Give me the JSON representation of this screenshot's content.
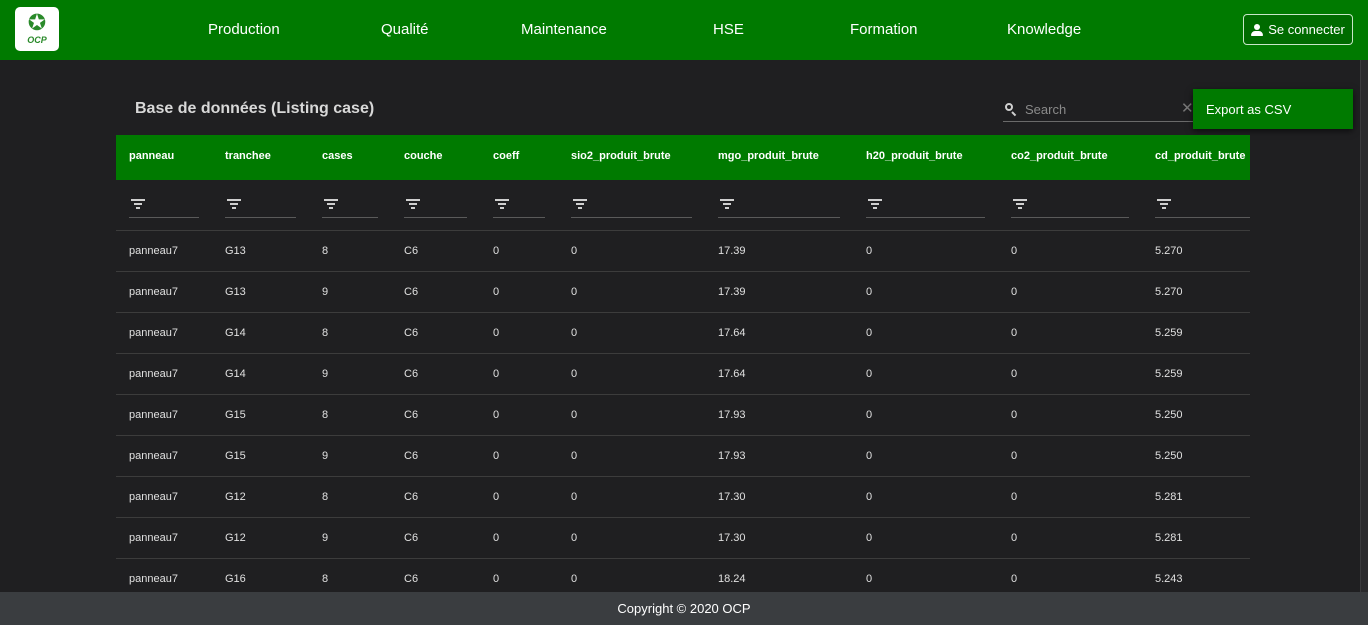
{
  "header": {
    "logo_text": "OCP",
    "nav": [
      "Production",
      "Qualité",
      "Maintenance",
      "HSE",
      "Formation",
      "Knowledge"
    ],
    "login_label": "Se connecter",
    "brand_color": "#007a00"
  },
  "page": {
    "title": "Base de données (Listing case)",
    "search_placeholder": "Search",
    "export_label": "Export as CSV"
  },
  "table": {
    "columns": [
      "panneau",
      "tranchee",
      "cases",
      "couche",
      "coeff",
      "sio2_produit_brute",
      "mgo_produit_brute",
      "h20_produit_brute",
      "co2_produit_brute",
      "cd_produit_brute"
    ],
    "rows": [
      [
        "panneau7",
        "G13",
        "8",
        "C6",
        "0",
        "0",
        "17.39",
        "0",
        "0",
        "5.270"
      ],
      [
        "panneau7",
        "G13",
        "9",
        "C6",
        "0",
        "0",
        "17.39",
        "0",
        "0",
        "5.270"
      ],
      [
        "panneau7",
        "G14",
        "8",
        "C6",
        "0",
        "0",
        "17.64",
        "0",
        "0",
        "5.259"
      ],
      [
        "panneau7",
        "G14",
        "9",
        "C6",
        "0",
        "0",
        "17.64",
        "0",
        "0",
        "5.259"
      ],
      [
        "panneau7",
        "G15",
        "8",
        "C6",
        "0",
        "0",
        "17.93",
        "0",
        "0",
        "5.250"
      ],
      [
        "panneau7",
        "G15",
        "9",
        "C6",
        "0",
        "0",
        "17.93",
        "0",
        "0",
        "5.250"
      ],
      [
        "panneau7",
        "G12",
        "8",
        "C6",
        "0",
        "0",
        "17.30",
        "0",
        "0",
        "5.281"
      ],
      [
        "panneau7",
        "G12",
        "9",
        "C6",
        "0",
        "0",
        "17.30",
        "0",
        "0",
        "5.281"
      ],
      [
        "panneau7",
        "G16",
        "8",
        "C6",
        "0",
        "0",
        "18.24",
        "0",
        "0",
        "5.243"
      ]
    ]
  },
  "footer": {
    "copyright": "Copyright © 2020 OCP"
  }
}
